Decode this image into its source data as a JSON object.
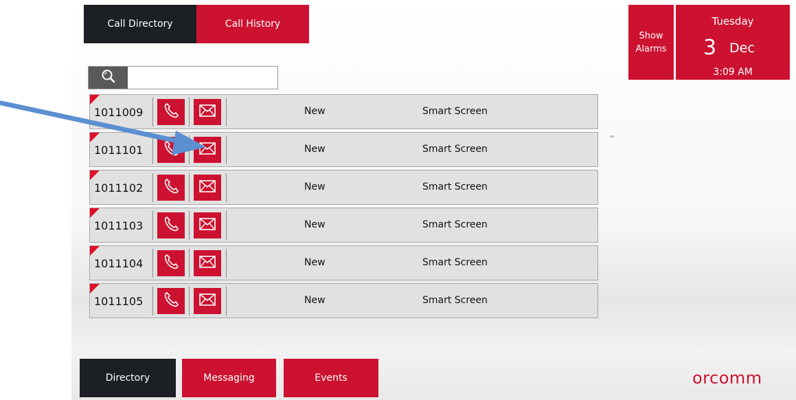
{
  "top_tabs": {
    "call_directory": "Call Directory",
    "call_history": "Call History"
  },
  "search": {
    "value": "",
    "placeholder": ""
  },
  "rows": [
    {
      "id": "1011009",
      "status": "New",
      "type": "Smart Screen"
    },
    {
      "id": "1011101",
      "status": "New",
      "type": "Smart Screen"
    },
    {
      "id": "1011102",
      "status": "New",
      "type": "Smart Screen"
    },
    {
      "id": "1011103",
      "status": "New",
      "type": "Smart Screen"
    },
    {
      "id": "1011104",
      "status": "New",
      "type": "Smart Screen"
    },
    {
      "id": "1011105",
      "status": "New",
      "type": "Smart Screen"
    }
  ],
  "alarms": {
    "line1": "Show",
    "line2": "Alarms"
  },
  "datetime": {
    "weekday": "Tuesday",
    "day": "3",
    "month": "Dec",
    "time": "3:09 AM"
  },
  "bottom_nav": {
    "directory": "Directory",
    "messaging": "Messaging",
    "events": "Events"
  },
  "brand": {
    "logo_text": "orcomm"
  },
  "colors": {
    "accent_red": "#cc1230",
    "dark": "#1c1f24",
    "arrow_blue": "#5b8fd0"
  },
  "icons": {
    "search": "search-icon",
    "call": "phone-icon",
    "message": "envelope-icon"
  }
}
